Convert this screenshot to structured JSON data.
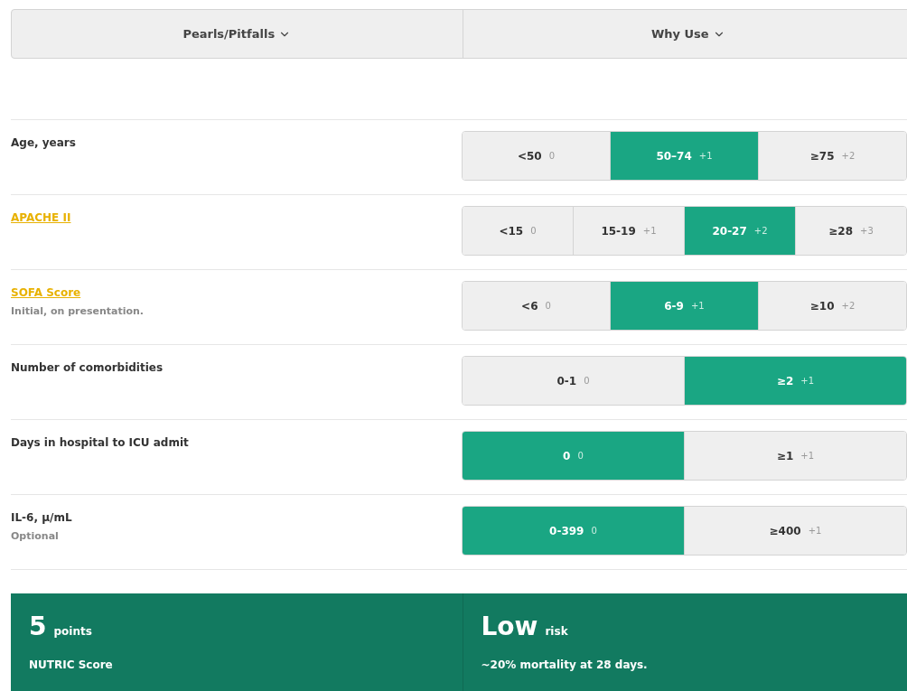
{
  "tabs": [
    {
      "label": "Pearls/Pitfalls"
    },
    {
      "label": "Why Use"
    }
  ],
  "rows": [
    {
      "label": "Age, years",
      "link": false,
      "options": [
        {
          "value": "<50",
          "points": "0",
          "selected": false
        },
        {
          "value": "50–74",
          "points": "+1",
          "selected": true
        },
        {
          "value": "≥75",
          "points": "+2",
          "selected": false
        }
      ]
    },
    {
      "label": "APACHE II",
      "link": true,
      "options": [
        {
          "value": "<15",
          "points": "0",
          "selected": false
        },
        {
          "value": "15-19",
          "points": "+1",
          "selected": false
        },
        {
          "value": "20-27",
          "points": "+2",
          "selected": true
        },
        {
          "value": "≥28",
          "points": "+3",
          "selected": false
        }
      ]
    },
    {
      "label": "SOFA Score",
      "link": true,
      "note": "Initial, on presentation.",
      "options": [
        {
          "value": "<6",
          "points": "0",
          "selected": false
        },
        {
          "value": "6-9",
          "points": "+1",
          "selected": true
        },
        {
          "value": "≥10",
          "points": "+2",
          "selected": false
        }
      ]
    },
    {
      "label": "Number of comorbidities",
      "link": false,
      "options": [
        {
          "value": "0-1",
          "points": "0",
          "selected": false
        },
        {
          "value": "≥2",
          "points": "+1",
          "selected": true
        }
      ]
    },
    {
      "label": "Days in hospital to ICU admit",
      "link": false,
      "options": [
        {
          "value": "0",
          "points": "0",
          "selected": true
        },
        {
          "value": "≥1",
          "points": "+1",
          "selected": false
        }
      ]
    },
    {
      "label": "IL-6, µ/mL",
      "link": false,
      "note": "Optional",
      "options": [
        {
          "value": "0-399",
          "points": "0",
          "selected": true
        },
        {
          "value": "≥400",
          "points": "+1",
          "selected": false
        }
      ]
    }
  ],
  "result": {
    "score": "5",
    "score_unit": "points",
    "score_name": "NUTRIC Score",
    "risk": "Low",
    "risk_unit": "risk",
    "risk_text": "~20% mortality at 28 days."
  }
}
